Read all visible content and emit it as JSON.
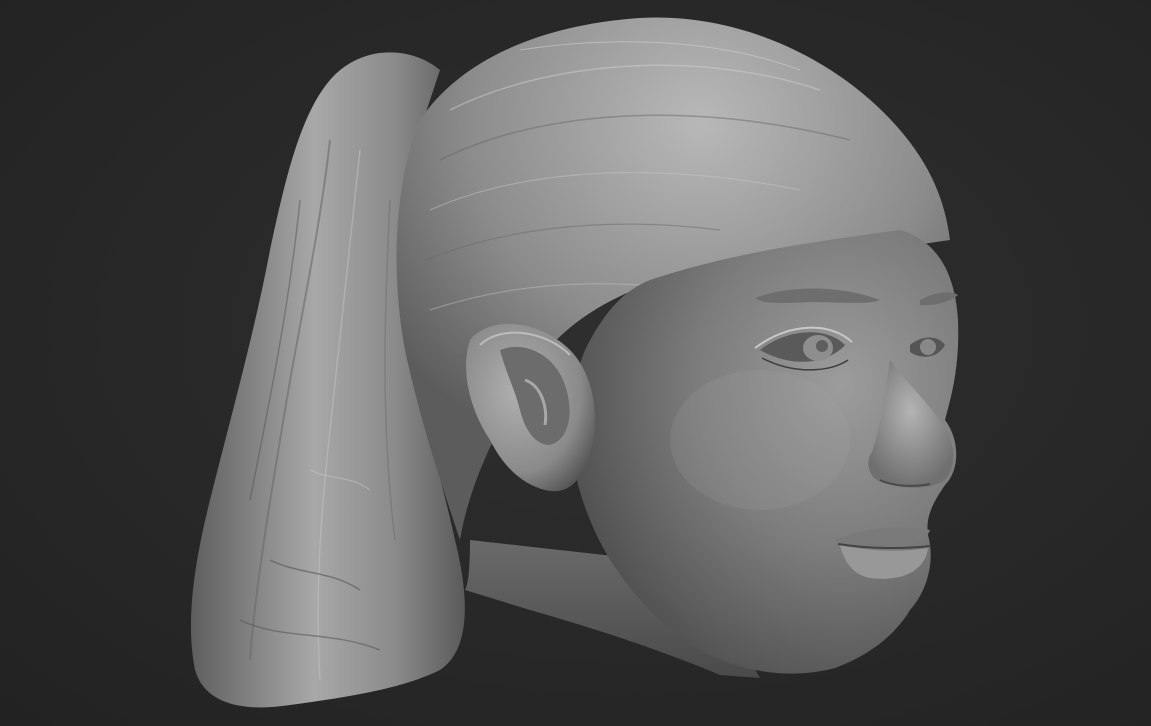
{
  "scene": {
    "background_color": "#2a2a2a",
    "material_color": "#9a9a9a",
    "subject": "sculpted-head-with-ponytail"
  }
}
